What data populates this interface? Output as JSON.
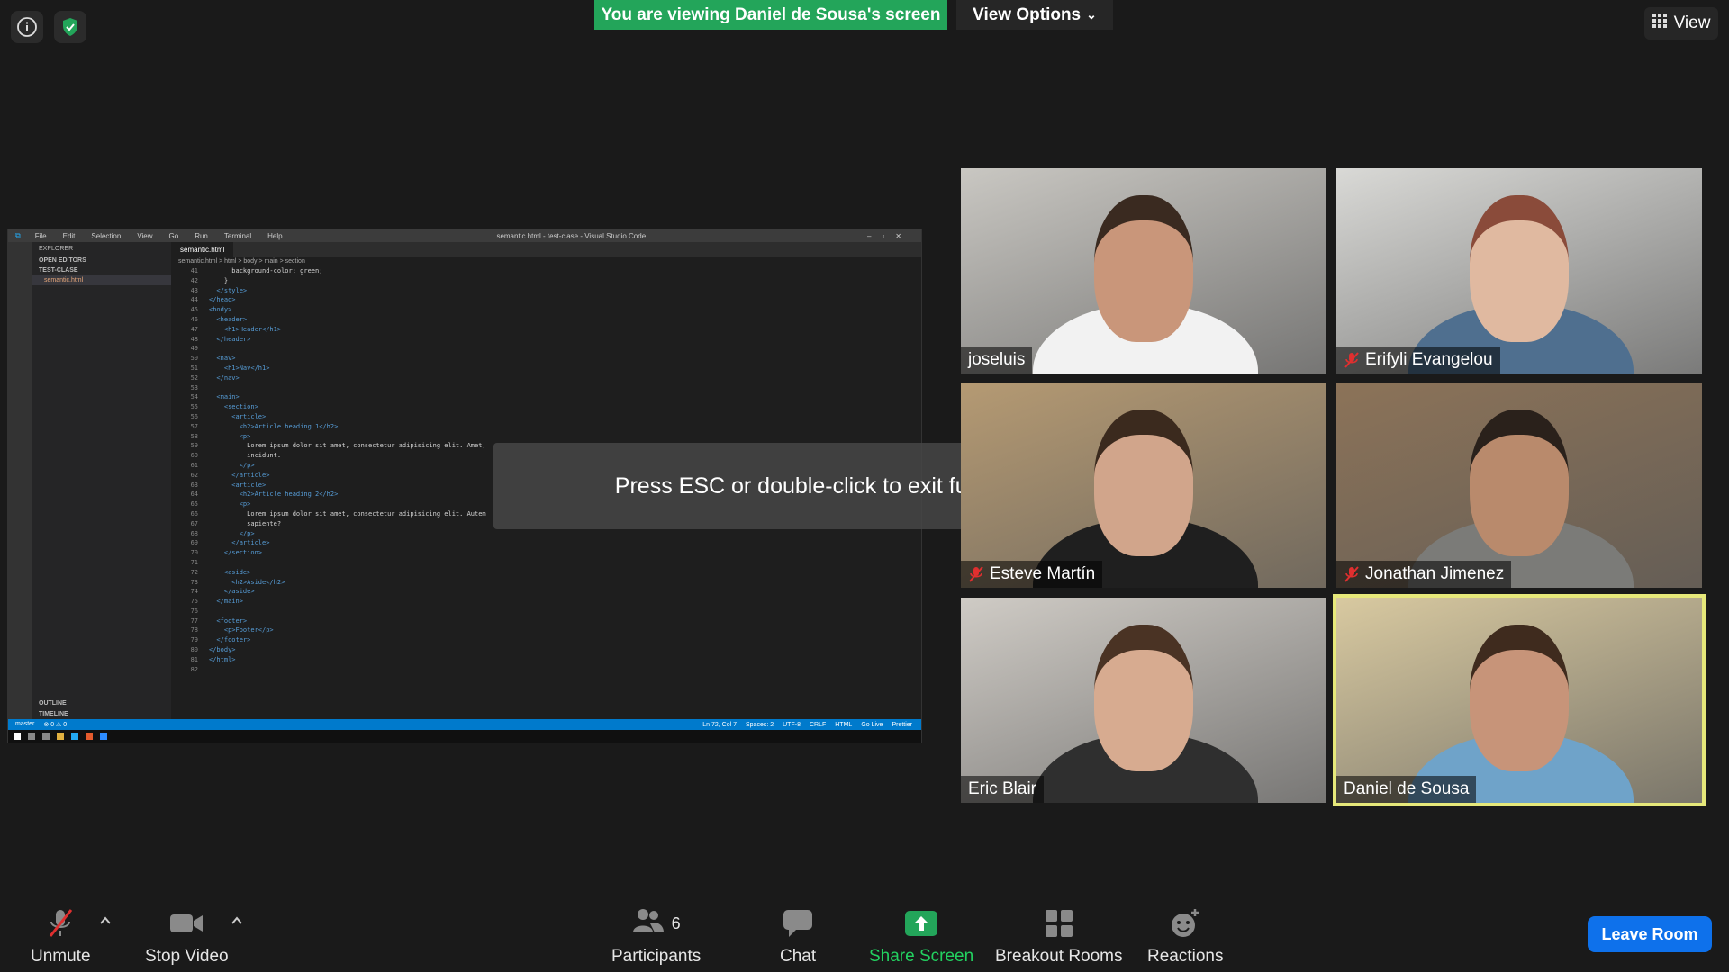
{
  "top_bar": {
    "sharing_banner": "You are viewing Daniel de Sousa's screen",
    "view_options": "View Options",
    "view_button": "View"
  },
  "shared_screen": {
    "window_title": "semantic.html - test-clase - Visual Studio Code",
    "menu": [
      "File",
      "Edit",
      "Selection",
      "View",
      "Go",
      "Run",
      "Terminal",
      "Help"
    ],
    "sidebar": {
      "explorer": "EXPLORER",
      "open_editors": "OPEN EDITORS",
      "folder": "TEST-CLASE",
      "file": "semantic.html",
      "outline": "OUTLINE",
      "timeline": "TIMELINE"
    },
    "tab": "semantic.html",
    "breadcrumb": "semantic.html > html > body > main > section",
    "code_lines": [
      {
        "n": "41",
        "t": "      background-color: green;"
      },
      {
        "n": "42",
        "t": "    }"
      },
      {
        "n": "43",
        "t": "  </style>"
      },
      {
        "n": "44",
        "t": "</head>"
      },
      {
        "n": "45",
        "t": "<body>"
      },
      {
        "n": "46",
        "t": "  <header>"
      },
      {
        "n": "47",
        "t": "    <h1>Header</h1>"
      },
      {
        "n": "48",
        "t": "  </header>"
      },
      {
        "n": "49",
        "t": ""
      },
      {
        "n": "50",
        "t": "  <nav>"
      },
      {
        "n": "51",
        "t": "    <h1>Nav</h1>"
      },
      {
        "n": "52",
        "t": "  </nav>"
      },
      {
        "n": "53",
        "t": ""
      },
      {
        "n": "54",
        "t": "  <main>"
      },
      {
        "n": "55",
        "t": "    <section>"
      },
      {
        "n": "56",
        "t": "      <article>"
      },
      {
        "n": "57",
        "t": "        <h2>Article heading 1</h2>"
      },
      {
        "n": "58",
        "t": "        <p>"
      },
      {
        "n": "59",
        "t": "          Lorem ipsum dolor sit amet, consectetur adipisicing elit. Amet,"
      },
      {
        "n": "60",
        "t": "          incidunt."
      },
      {
        "n": "61",
        "t": "        </p>"
      },
      {
        "n": "62",
        "t": "      </article>"
      },
      {
        "n": "63",
        "t": "      <article>"
      },
      {
        "n": "64",
        "t": "        <h2>Article heading 2</h2>"
      },
      {
        "n": "65",
        "t": "        <p>"
      },
      {
        "n": "66",
        "t": "          Lorem ipsum dolor sit amet, consectetur adipisicing elit. Autem"
      },
      {
        "n": "67",
        "t": "          sapiente?"
      },
      {
        "n": "68",
        "t": "        </p>"
      },
      {
        "n": "69",
        "t": "      </article>"
      },
      {
        "n": "70",
        "t": "    </section>"
      },
      {
        "n": "71",
        "t": ""
      },
      {
        "n": "72",
        "t": "    <aside>"
      },
      {
        "n": "73",
        "t": "      <h2>Aside</h2>"
      },
      {
        "n": "74",
        "t": "    </aside>"
      },
      {
        "n": "75",
        "t": "  </main>"
      },
      {
        "n": "76",
        "t": ""
      },
      {
        "n": "77",
        "t": "  <footer>"
      },
      {
        "n": "78",
        "t": "    <p>Footer</p>"
      },
      {
        "n": "79",
        "t": "  </footer>"
      },
      {
        "n": "80",
        "t": "</body>"
      },
      {
        "n": "81",
        "t": "</html>"
      },
      {
        "n": "82",
        "t": ""
      }
    ],
    "status_left": [
      "master",
      "⊗ 0 ⚠ 0"
    ],
    "status_right": [
      "Ln 72, Col 7",
      "Spaces: 2",
      "UTF-8",
      "CRLF",
      "HTML",
      "Go Live",
      "Prettier"
    ]
  },
  "overlay": {
    "message": "Press ESC or double-click to exit full screen mode"
  },
  "participants_tiles": [
    {
      "name": "joseluis",
      "muted": false,
      "bg": "#c9c7c2",
      "shirt": "#f2f2f2",
      "skin": "#c9967a",
      "hair": "#3a2a20"
    },
    {
      "name": "Erifyli Evangelou",
      "muted": true,
      "bg": "#d9d9d6",
      "shirt": "#4f6f8f",
      "skin": "#e0b9a0",
      "hair": "#8a4b3a"
    },
    {
      "name": "Esteve Martín",
      "muted": true,
      "bg": "#b59a73",
      "shirt": "#1f1f1f",
      "skin": "#d1a58b",
      "hair": "#3b2a1e"
    },
    {
      "name": "Jonathan Jimenez",
      "muted": true,
      "bg": "#8c7358",
      "shirt": "#7b7b78",
      "skin": "#b98a6c",
      "hair": "#2a211b"
    },
    {
      "name": "Eric Blair",
      "muted": false,
      "bg": "#cfcbc5",
      "shirt": "#2f2f2f",
      "skin": "#d7ab90",
      "hair": "#4a3324"
    },
    {
      "name": "Daniel de Sousa",
      "muted": false,
      "bg": "#d8c9a0",
      "shirt": "#6fa3c9",
      "skin": "#c79479",
      "hair": "#3f2b1e",
      "active": true
    }
  ],
  "toolbar": {
    "unmute": "Unmute",
    "stop_video": "Stop Video",
    "participants": "Participants",
    "participants_count": "6",
    "chat": "Chat",
    "share_screen": "Share Screen",
    "breakout_rooms": "Breakout Rooms",
    "reactions": "Reactions",
    "leave_room": "Leave Room"
  },
  "colors": {
    "share_green": "#23a55a",
    "leave_blue": "#0e71eb",
    "active_speaker": "#e6e87a",
    "muted_red": "#e02f2f"
  }
}
